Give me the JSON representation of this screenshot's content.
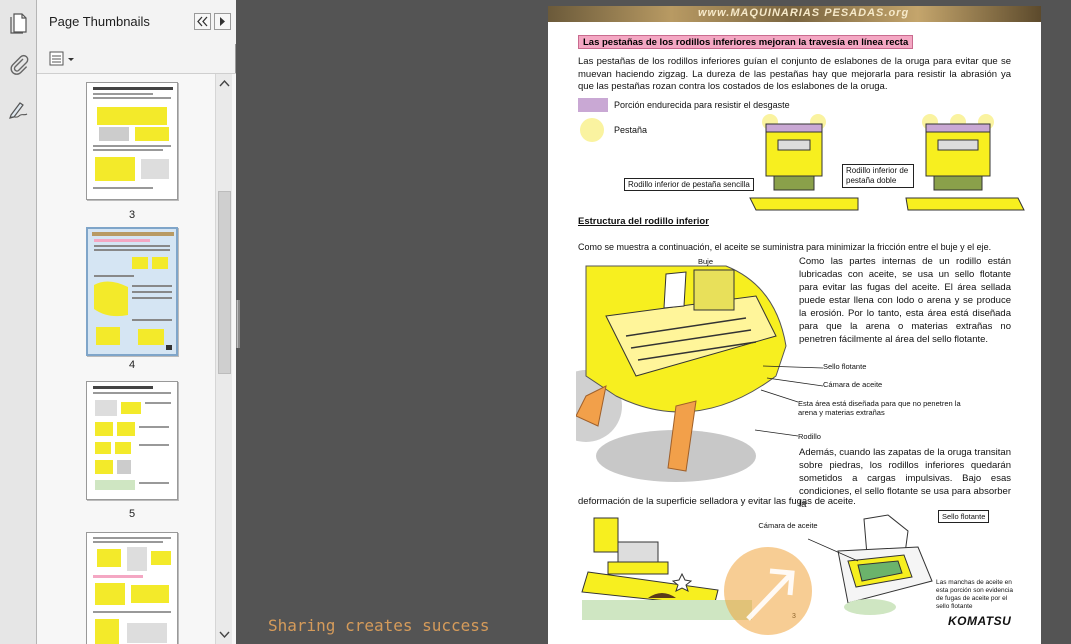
{
  "sidebar": {
    "tools": [
      {
        "name": "pages-icon"
      },
      {
        "name": "attachments-icon"
      },
      {
        "name": "signatures-icon"
      }
    ]
  },
  "thumbnails_pane": {
    "title": "Page Thumbnails",
    "pages": [
      {
        "number": ""
      },
      {
        "number": "3"
      },
      {
        "number": "4"
      },
      {
        "number": "5"
      },
      {
        "number": ""
      }
    ],
    "selected_page": "4"
  },
  "document": {
    "banner": "www.MAQUINARIAS PESADAS.org",
    "heading": "Las pestañas de los rodillos inferiores mejoran la travesía en línea recta",
    "intro_paragraph": "Las pestañas de los rodillos inferiores guían el conjunto de eslabones de la oruga para evitar que se muevan haciendo zigzag. La dureza de las pestañas hay que mejorarla para resistir la abrasión ya que las pestañas rozan contra los costados de los eslabones de la oruga.",
    "legend_hardened": "Porción endurecida para resistir el desgaste",
    "legend_flange": "Pestaña",
    "label_single": "Rodillo inferior de pestaña sencilla",
    "label_double": "Rodillo inferior de pestaña doble",
    "subheading": "Estructura del rodillo inferior",
    "oil_intro": "Como se muestra a continuación, el aceite se suministra para minimizar la fricción entre el buje y el eje.",
    "bushing_label": "Buje",
    "lubrication_paragraph": "Como las partes internas de un rodillo están lubricadas con aceite, se usa un sello flotante para evitar las fugas del aceite. El área sellada puede estar llena con lodo o arena y se produce la erosión. Por lo tanto, esta área está diseñada para que la arena o materias extrañas no penetren fácilmente al área del sello flotante.",
    "callout_seal": "Sello flotante",
    "callout_oil_chamber": "Cámara de aceite",
    "callout_area": "Esta área está diseñada para que no penetren la arena y materias extrañas",
    "callout_roller": "Rodillo",
    "load_paragraph": "Además, cuando las zapatas de la oruga transitan sobre piedras, los rodillos inferiores quedarán sometidos a cargas impulsivas. Bajo esas condiciones, el sello flotante se usa para absorber la",
    "load_paragraph_end": "deformación de la superficie selladora y evitar las fugas de aceite.",
    "bottom_oil_chamber": "Cámara de aceite",
    "bottom_seal": "Sello flotante",
    "stain_note": "Las manchas de aceite en esta porción son evidencia de fugas de aceite por el sello flotante",
    "page_number": "3",
    "brand": "KOMATSU",
    "watermark": "Sharing creates success"
  },
  "colors": {
    "highlight_yellow": "#f7ef1f",
    "hardened_purple": "#c9a8d4",
    "heading_pink": "#f4a7c3",
    "shoe_orange": "#f2a04a"
  }
}
